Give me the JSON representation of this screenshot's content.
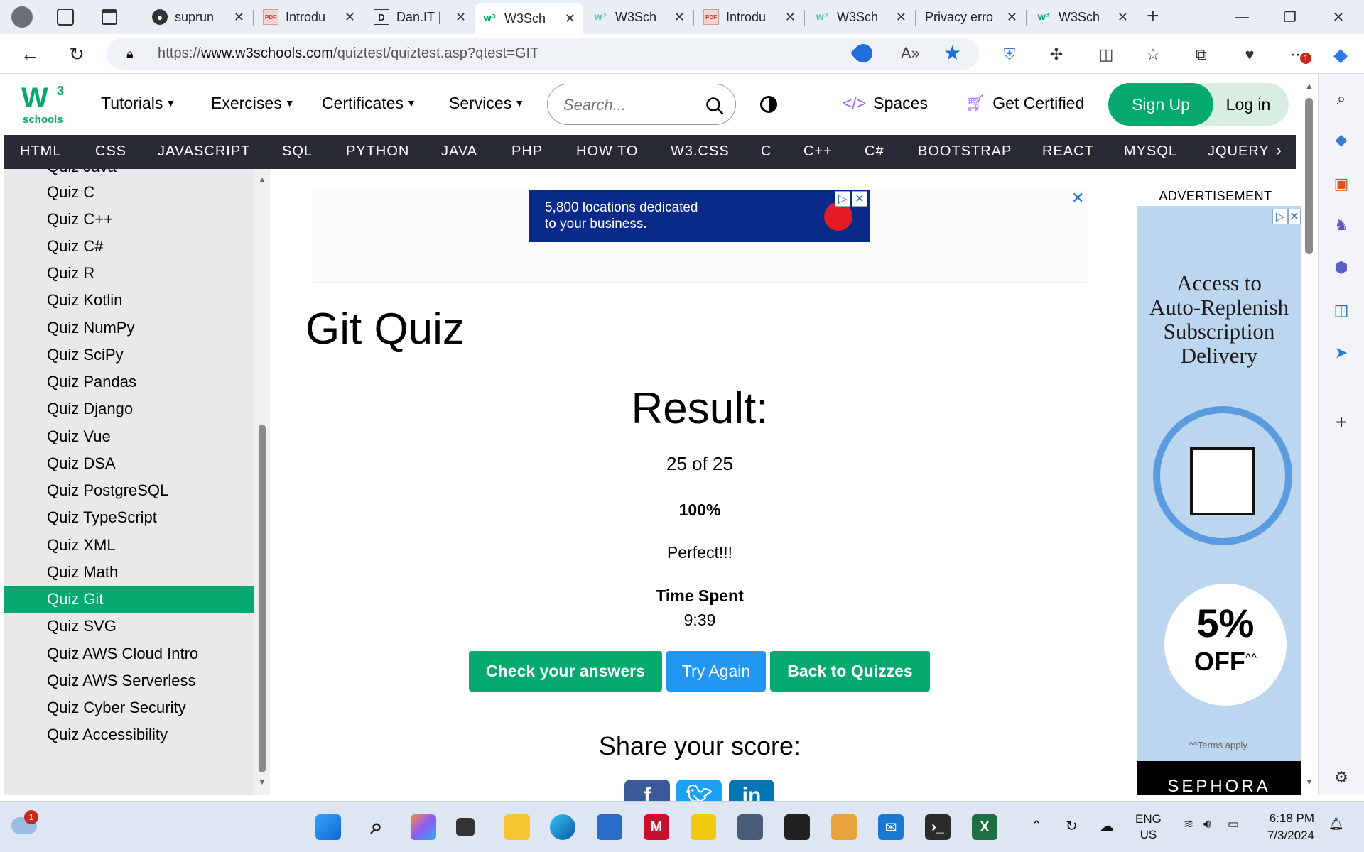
{
  "browser": {
    "tabs": [
      {
        "label": "suprun",
        "favicon": "github-icon"
      },
      {
        "label": "Introdu",
        "favicon": "pdf-icon"
      },
      {
        "label": "Dan.IT |",
        "favicon": "dan-it-icon"
      },
      {
        "label": "W3Sch",
        "favicon": "w3schools-icon",
        "active": true
      },
      {
        "label": "W3Sch",
        "favicon": "w3schools-icon"
      },
      {
        "label": "Introdu",
        "favicon": "pdf-icon"
      },
      {
        "label": "W3Sch",
        "favicon": "w3schools-icon"
      },
      {
        "label": "Privacy erro",
        "favicon": "none"
      },
      {
        "label": "W3Sch",
        "favicon": "w3schools-icon"
      }
    ],
    "url_prefix": "https://",
    "url_domain": "www.w3schools.com",
    "url_path": "/quiztest/quiztest.asp?qtest=GIT",
    "notification_count": "1"
  },
  "header": {
    "logo_main": "W",
    "logo_sup": "3",
    "logo_sub": "schools",
    "menus": [
      "Tutorials",
      "Exercises",
      "Certificates",
      "Services"
    ],
    "search_placeholder": "Search...",
    "spaces": "Spaces",
    "get_certified": "Get Certified",
    "signup": "Sign Up",
    "login": "Log in"
  },
  "topnav": [
    "HTML",
    "CSS",
    "JAVASCRIPT",
    "SQL",
    "PYTHON",
    "JAVA",
    "PHP",
    "HOW TO",
    "W3.CSS",
    "C",
    "C++",
    "C#",
    "BOOTSTRAP",
    "REACT",
    "MYSQL",
    "JQUERY"
  ],
  "sidebar": {
    "items": [
      {
        "label": "Quiz Java"
      },
      {
        "label": "Quiz C"
      },
      {
        "label": "Quiz C++"
      },
      {
        "label": "Quiz C#"
      },
      {
        "label": "Quiz R"
      },
      {
        "label": "Quiz Kotlin"
      },
      {
        "label": "Quiz NumPy"
      },
      {
        "label": "Quiz SciPy"
      },
      {
        "label": "Quiz Pandas"
      },
      {
        "label": "Quiz Django"
      },
      {
        "label": "Quiz Vue"
      },
      {
        "label": "Quiz DSA"
      },
      {
        "label": "Quiz PostgreSQL"
      },
      {
        "label": "Quiz TypeScript"
      },
      {
        "label": "Quiz XML"
      },
      {
        "label": "Quiz Math"
      },
      {
        "label": "Quiz Git",
        "active": true
      },
      {
        "label": "Quiz SVG"
      },
      {
        "label": "Quiz AWS Cloud Intro"
      },
      {
        "label": "Quiz AWS Serverless"
      },
      {
        "label": "Quiz Cyber Security"
      },
      {
        "label": "Quiz Accessibility"
      }
    ]
  },
  "ad_top": {
    "line1": "5,800 locations dedicated",
    "line2": "to your business."
  },
  "main": {
    "title": "Git Quiz",
    "result_heading": "Result:",
    "score": "25 of 25",
    "percent": "100%",
    "message": "Perfect!!!",
    "time_label": "Time Spent",
    "time_value": "9:39",
    "btn_check": "Check your answers",
    "btn_try": "Try Again",
    "btn_back": "Back to Quizzes",
    "share_heading": "Share your score:",
    "colors": {
      "green": "#04aa6d",
      "blue": "#2196f3",
      "dark": "#282a35"
    }
  },
  "ad_right": {
    "label": "ADVERTISEMENT",
    "headline": [
      "Access to",
      "Auto-Replenish",
      "Subscription",
      "Delivery"
    ],
    "discount": "5%",
    "discount_word": "OFF",
    "discount_mark": "^^",
    "terms": "^^Terms apply.",
    "brand": "SEPHORA"
  },
  "taskbar": {
    "weather_badge": "1",
    "lang": "ENG",
    "region": "US",
    "time": "6:18 PM",
    "date": "7/3/2024"
  }
}
